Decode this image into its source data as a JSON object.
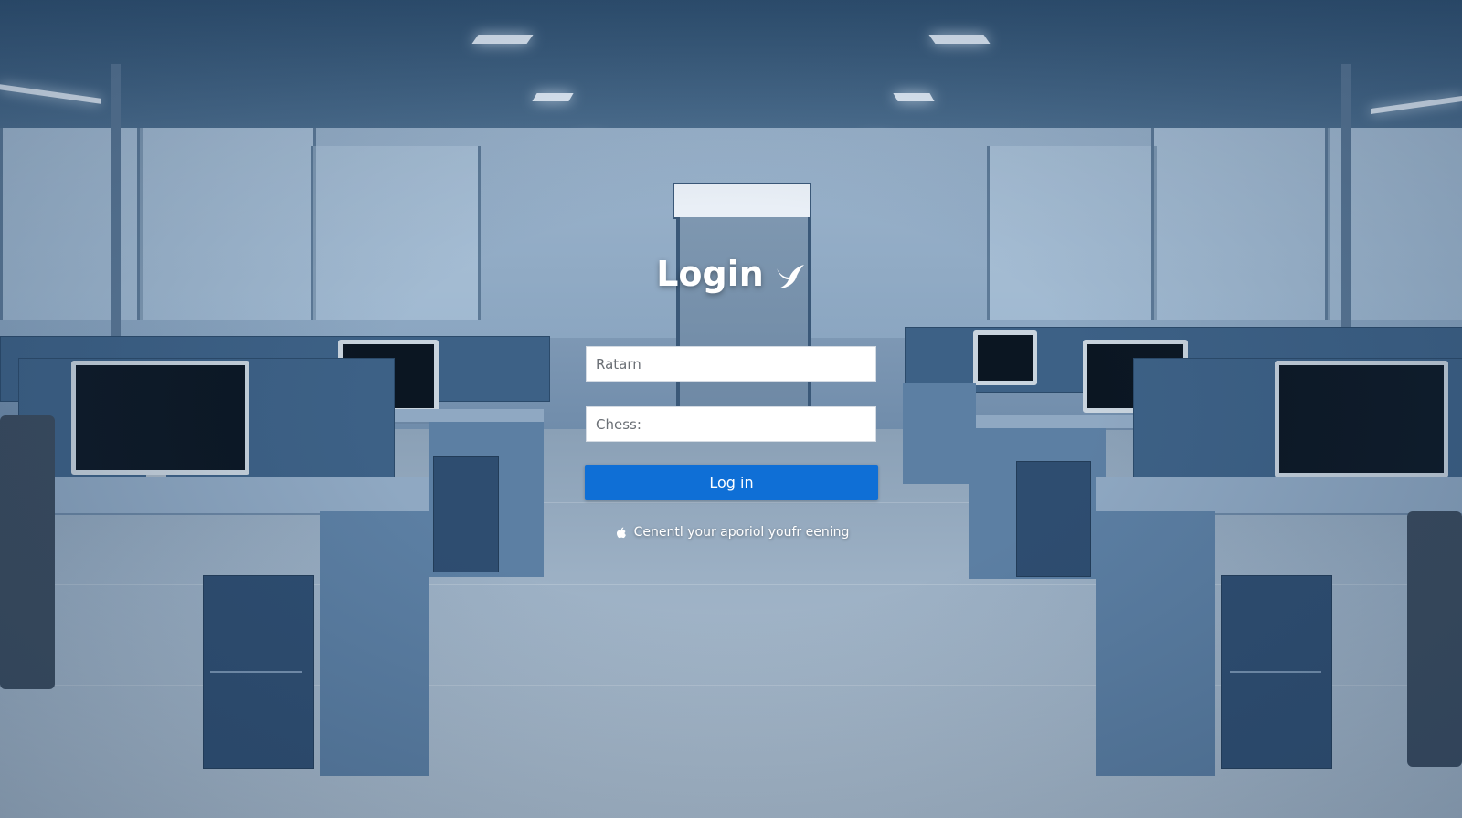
{
  "login": {
    "title": "Login",
    "title_icon": "bird-icon",
    "username_placeholder": "Ratarn",
    "password_placeholder": "Chess:",
    "submit_label": "Log in",
    "help_icon": "apple-icon",
    "help_text": "Cenentl your aporiol youfr eening"
  },
  "colors": {
    "button": "#0f6fd6",
    "field_bg": "#ffffff",
    "text": "#ffffff",
    "scene_tint": "#6c89a8"
  }
}
